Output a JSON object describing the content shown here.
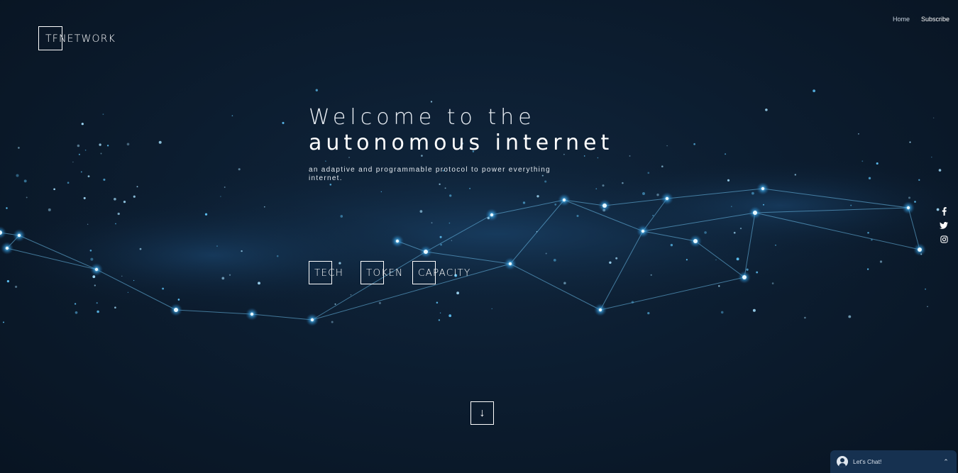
{
  "brand": {
    "logo_text": "TFNETWORK"
  },
  "nav": {
    "items": [
      {
        "label": "Home",
        "active": false
      },
      {
        "label": "Subscribe",
        "active": true
      }
    ]
  },
  "hero": {
    "line1": "Welcome to the",
    "line2": "autonomous internet",
    "subtitle": "an adaptive and programmable protocol to power everything internet."
  },
  "sections": [
    {
      "label": "TECH"
    },
    {
      "label": "TOKEN"
    },
    {
      "label": "CAPACITY"
    }
  ],
  "scroll_down": {
    "glyph": "↓",
    "icon": "arrow-down-icon"
  },
  "social": [
    {
      "icon": "facebook-icon"
    },
    {
      "icon": "twitter-icon"
    },
    {
      "icon": "instagram-icon"
    }
  ],
  "chat": {
    "label": "Let's Chat!",
    "icon": "user-avatar-icon",
    "caret_icon": "chevron-up-icon"
  },
  "colors": {
    "background": "#0b1a2b",
    "network_glow": "#4fb8f0",
    "node": "#ffffff",
    "chat_bg": "#163150"
  }
}
